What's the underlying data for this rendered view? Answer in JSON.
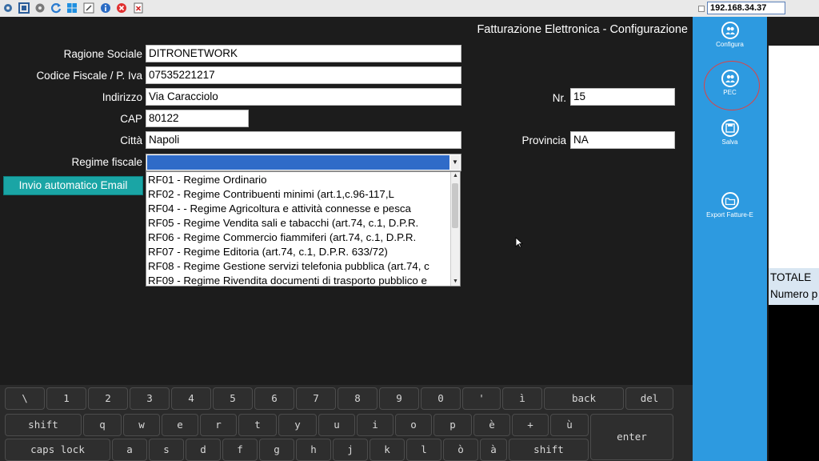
{
  "toolbar": {
    "ip_address": "192.168.34.37",
    "icons": [
      "settings-icon",
      "fullscreen-icon",
      "gear-icon",
      "refresh-icon",
      "windows-icon",
      "logout-icon",
      "info-icon",
      "stop-icon",
      "file-close-icon"
    ]
  },
  "window": {
    "title": "Fatturazione Elettronica - Configurazione"
  },
  "form": {
    "ragione_sociale": {
      "label": "Ragione Sociale",
      "value": "DITRONETWORK"
    },
    "codice_fiscale": {
      "label": "Codice Fiscale / P. Iva",
      "value": "07535221217"
    },
    "indirizzo": {
      "label": "Indirizzo",
      "value": "Via Caracciolo"
    },
    "numero": {
      "label": "Nr.",
      "value": "15"
    },
    "cap": {
      "label": "CAP",
      "value": "80122"
    },
    "citta": {
      "label": "Città",
      "value": "Napoli"
    },
    "provincia": {
      "label": "Provincia",
      "value": "NA"
    },
    "regime_fiscale": {
      "label": "Regime fiscale",
      "options": [
        "RF01 - Regime Ordinario",
        "RF02 - Regime Contribuenti minimi (art.1,c.96-117,L",
        "RF04 -  - Regime Agricoltura e attività connesse e pesca",
        "RF05 - Regime Vendita sali e tabacchi (art.74, c.1, D.P.R.",
        "RF06 - Regime Commercio fiammiferi (art.74, c.1, D.P.R.",
        "RF07 - Regime Editoria (art.74, c.1, D.P.R. 633/72)",
        "RF08 - Regime Gestione servizi telefonia pubblica (art.74, c",
        "RF09 - Regime Rivendita documenti di trasporto pubblico e"
      ]
    },
    "email_button": "Invio automatico Email"
  },
  "side_panel": {
    "configura": "Configura",
    "pec": "PEC",
    "salva": "Salva",
    "export": "Export Fatture-E"
  },
  "right_window": {
    "totale": "TOTALE",
    "numero": "Numero p"
  },
  "keyboard": {
    "row1": [
      "\\",
      "1",
      "2",
      "3",
      "4",
      "5",
      "6",
      "7",
      "8",
      "9",
      "0",
      "'",
      "ì",
      "back",
      "del"
    ],
    "row2": [
      "shift",
      "q",
      "w",
      "e",
      "r",
      "t",
      "y",
      "u",
      "i",
      "o",
      "p",
      "è",
      "+",
      "ù",
      "enter"
    ],
    "row3": [
      "caps lock",
      "a",
      "s",
      "d",
      "f",
      "g",
      "h",
      "j",
      "k",
      "l",
      "ò",
      "à",
      "shift"
    ]
  },
  "colors": {
    "background": "#1c1c1c",
    "side_panel": "#2d9ae0",
    "email_button": "#1aa5a5",
    "selection": "#2f6bc8",
    "pec_highlight": "#e24040"
  }
}
